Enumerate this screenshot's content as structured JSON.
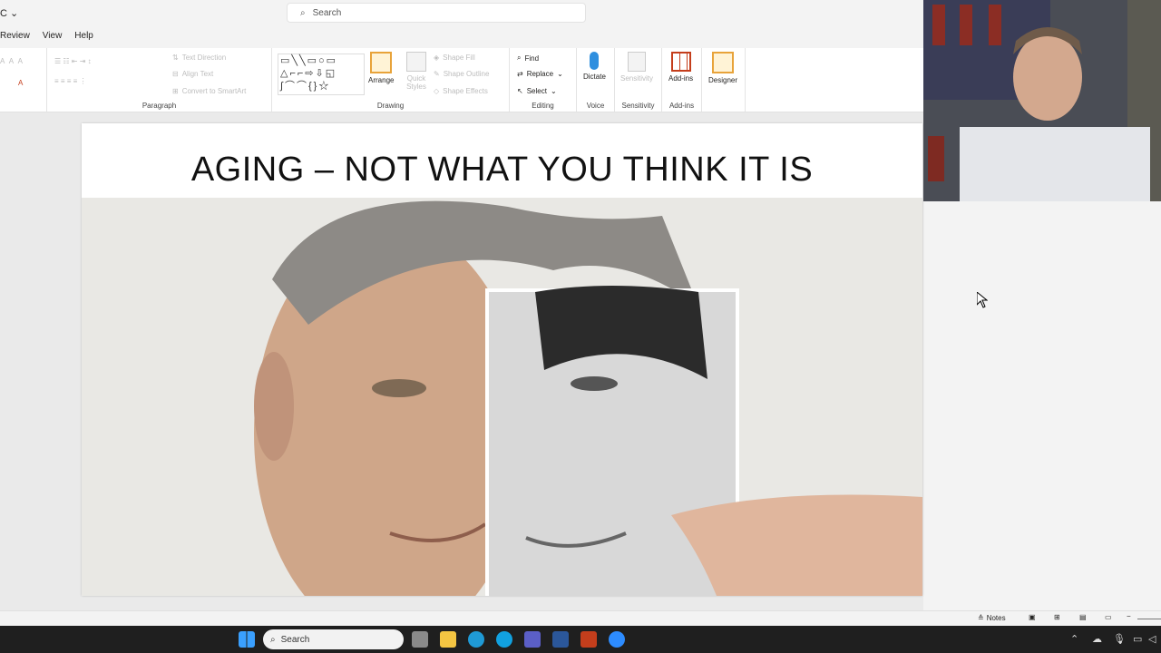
{
  "window": {
    "title_fragment": "C",
    "chevron": "chevron-down-icon"
  },
  "search": {
    "placeholder": "Search"
  },
  "menu": {
    "tabs": [
      "Review",
      "View",
      "Help"
    ]
  },
  "ribbon": {
    "paragraph": {
      "label": "Paragraph"
    },
    "text_tools": {
      "text_direction": "Text Direction",
      "align_text": "Align Text",
      "convert_smartart": "Convert to SmartArt"
    },
    "drawing": {
      "label": "Drawing",
      "arrange": "Arrange",
      "quick_styles": "Quick Styles",
      "shape_fill": "Shape Fill",
      "shape_outline": "Shape Outline",
      "shape_effects": "Shape Effects"
    },
    "editing": {
      "label": "Editing",
      "find": "Find",
      "replace": "Replace",
      "select": "Select"
    },
    "voice": {
      "label": "Voice",
      "dictate": "Dictate"
    },
    "sensitivity": {
      "label": "Sensitivity",
      "button": "Sensitivity"
    },
    "addins": {
      "label": "Add-ins",
      "button": "Add-ins"
    },
    "designer": {
      "button": "Designer"
    }
  },
  "slide": {
    "title": "AGING – NOT WHAT YOU THINK IT IS"
  },
  "status": {
    "notes": "Notes"
  },
  "taskbar": {
    "search": "Search"
  },
  "colors": {
    "accent": "#c43e1c",
    "taskbar": "#1f1f1f",
    "ribbon_bg": "#ffffff"
  }
}
